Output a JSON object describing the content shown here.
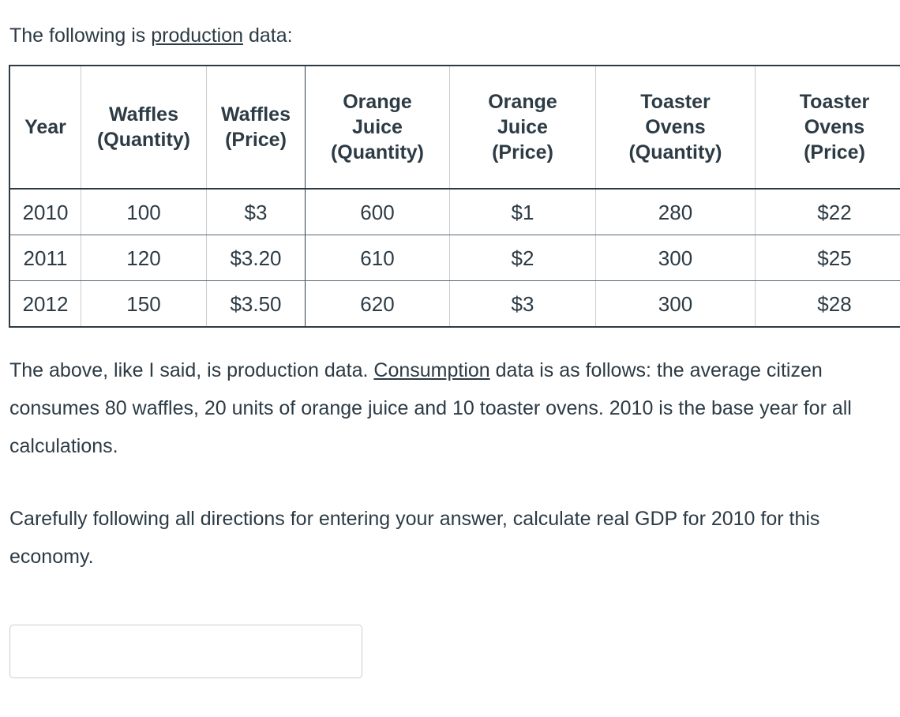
{
  "intro": {
    "before": "The following is ",
    "underlined": "production",
    "after": " data:"
  },
  "table": {
    "headers": [
      "Year",
      "Waffles (Quantity)",
      "Waffles (Price)",
      "Orange Juice (Quantity)",
      "Orange Juice (Price)",
      "Toaster Ovens (Quantity)",
      "Toaster Ovens (Price)"
    ],
    "header_lines": [
      [
        "Year"
      ],
      [
        "Waffles",
        "(Quantity)"
      ],
      [
        "Waffles",
        "(Price)"
      ],
      [
        "Orange",
        "Juice",
        "(Quantity)"
      ],
      [
        "Orange",
        "Juice",
        "(Price)"
      ],
      [
        "Toaster",
        "Ovens",
        "(Quantity)"
      ],
      [
        "Toaster",
        "Ovens",
        "(Price)"
      ]
    ],
    "rows": [
      [
        "2010",
        "100",
        "$3",
        "600",
        "$1",
        "280",
        "$22"
      ],
      [
        "2011",
        "120",
        "$3.20",
        "610",
        "$2",
        "300",
        "$25"
      ],
      [
        "2012",
        "150",
        "$3.50",
        "620",
        "$3",
        "300",
        "$28"
      ]
    ]
  },
  "paragraphs": {
    "consumption": {
      "before": "The above, like I said, is production data.  ",
      "underlined": "Consumption",
      "after": " data is as follows: the average citizen consumes 80 waffles, 20 units of orange juice and 10 toaster ovens.  2010 is the base year for all calculations."
    },
    "question": "Carefully following all directions for entering your answer, calculate real GDP for 2010 for this economy."
  },
  "answer": {
    "value": "",
    "placeholder": ""
  },
  "colors": {
    "text": "#2d3b45",
    "table_border": "#2d3b45",
    "cell_divider": "#c7cdd1",
    "row_divider": "#5a6a74",
    "input_border": "#c7cdd1",
    "background": "#ffffff"
  }
}
